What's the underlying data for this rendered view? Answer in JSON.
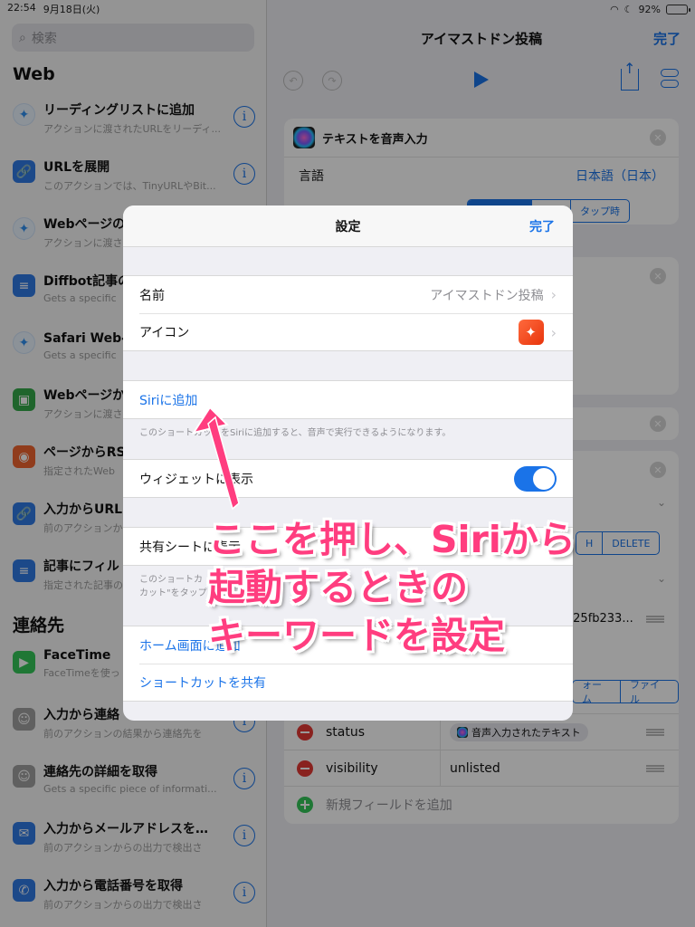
{
  "status_bar": {
    "time": "22:54",
    "date": "9月18日(火)",
    "battery": "92%",
    "battery_level": 0.92
  },
  "sidebar": {
    "search_placeholder": "検索",
    "sections": [
      {
        "title": "Web"
      },
      {
        "title": "連絡先"
      }
    ],
    "items": [
      {
        "title": "リーディングリストに追加",
        "sub": "アクションに渡されたURLをリーディ...",
        "icon": "safari-icon",
        "color": "#2f8ff0"
      },
      {
        "title": "URLを展開",
        "sub": "このアクションでは、TinyURLやBit...",
        "icon": "link-icon",
        "color": "#2f7ae5"
      },
      {
        "title": "Webページの",
        "sub": "アクションに渡され",
        "icon": "safari-icon",
        "color": "#2f8ff0"
      },
      {
        "title": "Diffbot記事の",
        "sub": "Gets a specific",
        "icon": "document-icon",
        "color": "#2f7ae5"
      },
      {
        "title": "Safari Webペ",
        "sub": "Gets a specific",
        "icon": "safari-icon",
        "color": "#2f8ff0"
      },
      {
        "title": "Webページか",
        "sub": "アクションに渡され",
        "icon": "save-icon",
        "color": "#34a84a"
      },
      {
        "title": "ページからRS",
        "sub": "指定されたWeb",
        "icon": "rss-icon",
        "color": "#f0642f"
      },
      {
        "title": "入力からURL",
        "sub": "前のアクションから",
        "icon": "link-icon",
        "color": "#2f7ae5"
      },
      {
        "title": "記事にフィル",
        "sub": "指定された記事の",
        "icon": "document-icon",
        "color": "#2f7ae5"
      },
      {
        "title": "FaceTime",
        "sub": "FaceTimeを使っ",
        "icon": "facetime-icon",
        "color": "#34c759"
      },
      {
        "title": "入力から連絡",
        "sub": "前のアクションの結果から連絡先を",
        "icon": "contacts-icon",
        "color": "#a0a0a0"
      },
      {
        "title": "連絡先の詳細を取得",
        "sub": "Gets a specific piece of informati...",
        "icon": "contacts-icon",
        "color": "#a0a0a0"
      },
      {
        "title": "入力からメールアドレスを…",
        "sub": "前のアクションからの出力で検出さ",
        "icon": "mail-icon",
        "color": "#2f7ae5"
      },
      {
        "title": "入力から電話番号を取得",
        "sub": "前のアクションからの出力で検出さ",
        "icon": "phone-icon",
        "color": "#2f7ae5"
      }
    ]
  },
  "main": {
    "title": "アイマストドン投稿",
    "done": "完了",
    "card1": {
      "title": "テキストを音声入力",
      "lang_label": "言語",
      "lang_value": "日本語（日本）",
      "segments": [
        "",
        "止後",
        "タップ時"
      ]
    },
    "seg_delete": [
      "H",
      "DELETE"
    ],
    "hash_value": "c25fb233...",
    "seg_file": [
      "ォーム",
      "ファイル"
    ],
    "fields": [
      {
        "key": "status",
        "value": "音声入力されたテキスト"
      },
      {
        "key": "visibility",
        "value": "unlisted"
      }
    ],
    "add_field": "新規フィールドを追加"
  },
  "modal": {
    "title": "設定",
    "done": "完了",
    "name_label": "名前",
    "name_value": "アイマストドン投稿",
    "icon_label": "アイコン",
    "siri_add": "Siriに追加",
    "siri_note": "このショートカットをSiriに追加すると、音声で実行できるようになります。",
    "widget_label": "ウィジェットに表示",
    "widget_on": true,
    "share_sheet_label": "共有シートに表示",
    "share_note_1": "このショートカ",
    "share_note_1b": "ョート",
    "share_note_2": "カット\"をタップ",
    "home_screen": "ホーム画面に追加",
    "share_shortcut": "ショートカットを共有"
  },
  "annotation": {
    "line1": "ここを押し、Siriから",
    "line2": "起動するときの",
    "line3": "キーワードを設定",
    "color": "#ff3d7f"
  }
}
